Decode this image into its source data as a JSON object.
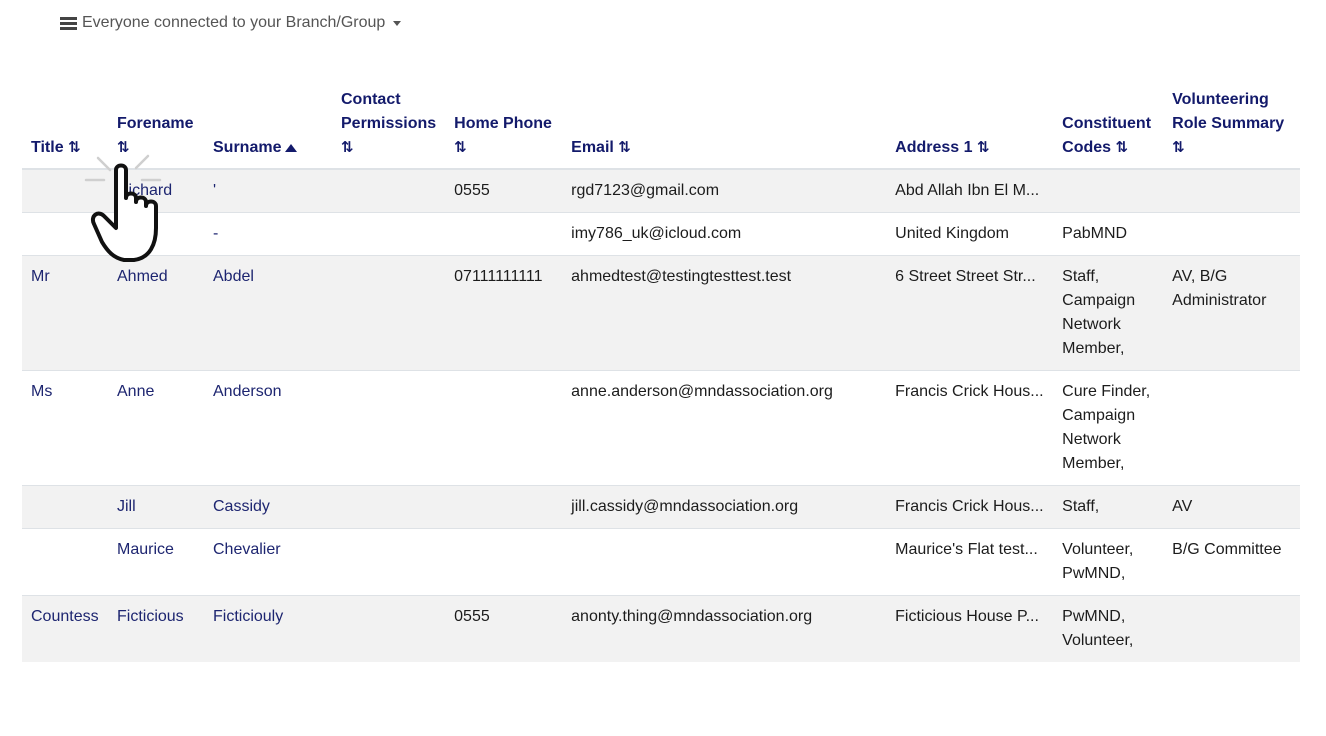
{
  "view_selector": {
    "label": "Everyone connected to your Branch/Group",
    "icon": "list-icon"
  },
  "table": {
    "headers": [
      {
        "label": "Title",
        "sort": "⇅"
      },
      {
        "label": "Forename",
        "sort": "⇅"
      },
      {
        "label": "Surname",
        "sort": "▲"
      },
      {
        "label": "Contact Permissions",
        "sort": "⇅"
      },
      {
        "label": "Home Phone",
        "sort": "⇅"
      },
      {
        "label": "Email",
        "sort": "⇅"
      },
      {
        "label": "Address 1",
        "sort": "⇅"
      },
      {
        "label": "Constituent Codes",
        "sort": "⇅"
      },
      {
        "label": "Volunteering Role Summary",
        "sort": "⇅"
      }
    ],
    "rows": [
      {
        "title": "",
        "forename": "Richard",
        "surname": "'",
        "permissions": "",
        "phone": "0555",
        "email": "rgd7123@gmail.com",
        "address": "Abd Allah Ibn El M...",
        "codes": "",
        "roles": ""
      },
      {
        "title": "",
        "forename": "",
        "surname": "-",
        "permissions": "",
        "phone": "",
        "email": "imy786_uk@icloud.com",
        "address": "United Kingdom",
        "codes": "PabMND",
        "roles": ""
      },
      {
        "title": "Mr",
        "forename": "Ahmed",
        "surname": "Abdel",
        "permissions": "",
        "phone": "07111111111",
        "email": "ahmedtest@testingtesttest.test",
        "address": "6 Street Street Str...",
        "codes": "Staff, Campaign Network Member,",
        "roles": "AV, B/G Administrator"
      },
      {
        "title": "Ms",
        "forename": "Anne",
        "surname": "Anderson",
        "permissions": "",
        "phone": "",
        "email": "anne.anderson@mndassociation.org",
        "address": "Francis Crick Hous...",
        "codes": "Cure Finder, Campaign Network Member,",
        "roles": ""
      },
      {
        "title": "",
        "forename": "Jill",
        "surname": "Cassidy",
        "permissions": "",
        "phone": "",
        "email": "jill.cassidy@mndassociation.org",
        "address": "Francis Crick Hous...",
        "codes": "Staff,",
        "roles": "AV"
      },
      {
        "title": "",
        "forename": "Maurice",
        "surname": "Chevalier",
        "permissions": "",
        "phone": "",
        "email": "",
        "address": "Maurice's Flat test...",
        "codes": "Volunteer, PwMND,",
        "roles": "B/G Committee"
      },
      {
        "title": "Countess",
        "forename": "Ficticious",
        "surname": "Ficticiouly",
        "permissions": "",
        "phone": "0555",
        "email": "anonty.thing@mndassociation.org",
        "address": "Ficticious House P...",
        "codes": "PwMND, Volunteer,",
        "roles": ""
      }
    ]
  },
  "cursor": {
    "icon": "pointer-hand-icon"
  },
  "colors": {
    "header": "#131a6b",
    "link": "#1d2570",
    "stripe": "#f2f2f2"
  }
}
